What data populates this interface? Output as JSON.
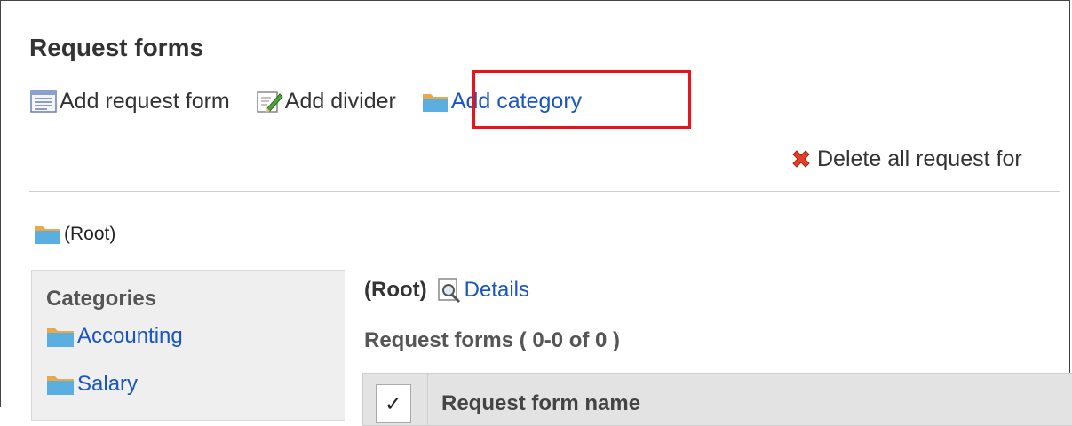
{
  "page": {
    "title": "Request forms"
  },
  "toolbar": {
    "add_request_form": "Add request form",
    "add_divider": "Add divider",
    "add_category": "Add category"
  },
  "actions": {
    "delete_all": "Delete all request for"
  },
  "breadcrumb": {
    "root": "(Root)"
  },
  "sidebar": {
    "title": "Categories",
    "items": [
      {
        "label": "Accounting"
      },
      {
        "label": "Salary"
      }
    ]
  },
  "main": {
    "root_label": "(Root)",
    "details_label": "Details",
    "forms_count": "Request forms ( 0-0 of 0 )",
    "table": {
      "check_header": "✓",
      "columns": [
        "Request form name"
      ]
    }
  },
  "colors": {
    "link": "#1a55c2",
    "highlight": "#e8131b",
    "delete": "#e0402a",
    "folder": "#5aaee0"
  },
  "icons": {
    "add_request_form": "form-list-icon",
    "add_divider": "edit-note-icon",
    "add_category": "folder-icon",
    "delete_all": "delete-x-icon",
    "details": "magnifier-icon"
  }
}
